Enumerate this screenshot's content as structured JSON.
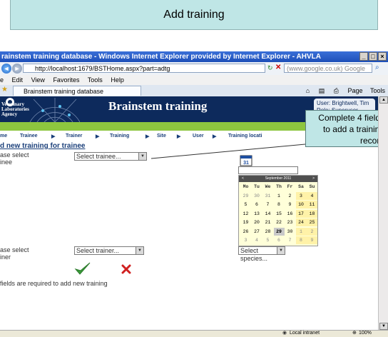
{
  "slide": {
    "title": "Add training"
  },
  "callout": {
    "text": "Complete 4 fields to add a training record"
  },
  "browser": {
    "title": "rainstem training database - Windows Internet Explorer provided by Internet Explorer - AHVLA",
    "address": "http://localhost:1679/BSTHome.aspx?part=adtg",
    "search_placeholder": "(www.google.co.uk) Google",
    "menu": [
      "e",
      "Edit",
      "View",
      "Favorites",
      "Tools",
      "Help"
    ],
    "tab_label": "Brainstem training database",
    "toolbar_page": "Page",
    "toolbar_tools": "Tools",
    "status_zone": "Local intranet",
    "zoom": "100%"
  },
  "header": {
    "app_title": "Brainstem training",
    "agency_lines": [
      "Veterinary",
      "Laboratories",
      "Agency"
    ],
    "user_line1": "User: Brightwell, Tim",
    "user_line2": "Role: Superuser"
  },
  "nav": [
    "me",
    "Trainee",
    "Trainer",
    "Training",
    "Site",
    "User",
    "Training locati"
  ],
  "form": {
    "heading": "d new training for trainee",
    "trainee_label_1": "ase select",
    "trainee_label_2": "inee",
    "trainee_select": "Select trainee...",
    "trainer_label_1": "ase select",
    "trainer_label_2": "iner",
    "trainer_select": "Select trainer...",
    "species_select": "Select species...",
    "footer_note": "fields are required to add new training"
  },
  "calendar": {
    "prev": "<",
    "next": ">",
    "month": "September 2011",
    "days": [
      "Mo",
      "Tu",
      "We",
      "Th",
      "Fr",
      "Sa",
      "Su"
    ],
    "weeks": [
      [
        "29",
        "30",
        "31",
        "1",
        "2",
        "3",
        "4"
      ],
      [
        "5",
        "6",
        "7",
        "8",
        "9",
        "10",
        "11"
      ],
      [
        "12",
        "13",
        "14",
        "15",
        "16",
        "17",
        "18"
      ],
      [
        "19",
        "20",
        "21",
        "22",
        "23",
        "24",
        "25"
      ],
      [
        "26",
        "27",
        "28",
        "29",
        "30",
        "1",
        "2"
      ],
      [
        "3",
        "4",
        "5",
        "6",
        "7",
        "8",
        "9"
      ]
    ],
    "today": "29"
  },
  "colors": {
    "header_bg": "#0d2a5c",
    "green_band": "#8dc63f",
    "callout_bg": "#bfe6e6",
    "calendar_bg": "#ffffd9"
  }
}
